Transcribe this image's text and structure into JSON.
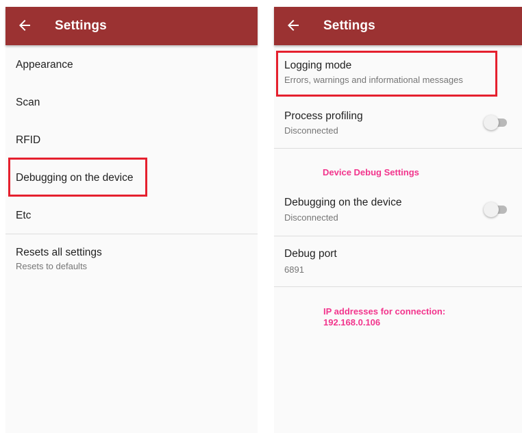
{
  "left_screen": {
    "title": "Settings",
    "items": [
      {
        "label": "Appearance"
      },
      {
        "label": "Scan"
      },
      {
        "label": "RFID"
      },
      {
        "label": "Debugging on the device"
      },
      {
        "label": "Etc"
      }
    ],
    "reset": {
      "label": "Resets all settings",
      "sub": "Resets to defaults"
    }
  },
  "right_screen": {
    "title": "Settings",
    "logging": {
      "label": "Logging mode",
      "sub": "Errors, warnings and informational messages"
    },
    "profiling": {
      "label": "Process profiling",
      "sub": "Disconnected"
    },
    "section_header": "Device Debug Settings",
    "debugging": {
      "label": "Debugging on the device",
      "sub": "Disconnected"
    },
    "debug_port": {
      "label": "Debug port",
      "sub": "6891"
    },
    "ip_label": "IP addresses for connection:",
    "ip_value": "192.168.0.106"
  },
  "colors": {
    "appbar": "#9b3232",
    "accent": "#f2348c",
    "highlight": "#e5202e"
  }
}
